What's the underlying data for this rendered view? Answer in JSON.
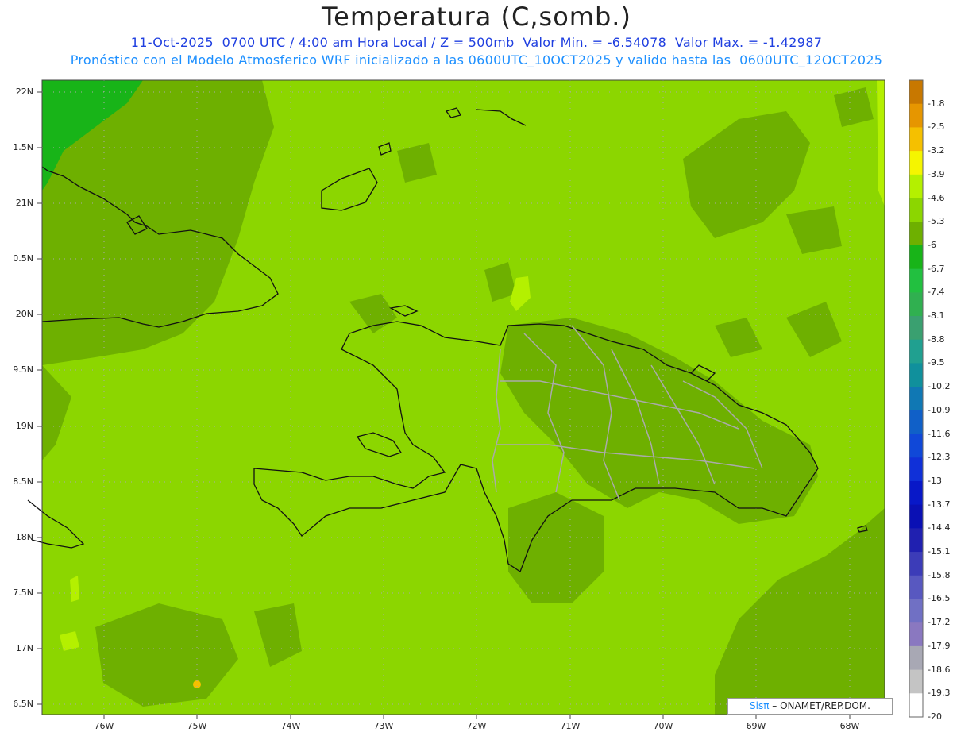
{
  "header": {
    "title": "Temperatura (C,somb.)",
    "subtitle_line1": "11-Oct-2025  0700 UTC / 4:00 am Hora Local / Z = 500mb  Valor Min. = -6.54078  Valor Max. = -1.42987",
    "subtitle_line2": "Pronóstico con el Modelo Atmosferico WRF inicializado a las 0600UTC_10OCT2025 y valido hasta las  0600UTC_12OCT2025"
  },
  "axes": {
    "lat_labels": [
      "22N",
      "1.5N",
      "21N",
      "0.5N",
      "20N",
      "9.5N",
      "19N",
      "8.5N",
      "18N",
      "7.5N",
      "17N",
      "6.5N"
    ],
    "lon_labels": [
      "76W",
      "75W",
      "74W",
      "73W",
      "72W",
      "71W",
      "70W",
      "69W",
      "68W"
    ]
  },
  "colorbar": {
    "labels": [
      "-1.8",
      "-2.5",
      "-3.2",
      "-3.9",
      "-4.6",
      "-5.3",
      "-6",
      "-6.7",
      "-7.4",
      "-8.1",
      "-8.8",
      "-9.5",
      "-10.2",
      "-10.9",
      "-11.6",
      "-12.3",
      "-13",
      "-13.7",
      "-14.4",
      "-15.1",
      "-15.8",
      "-16.5",
      "-17.2",
      "-17.9",
      "-18.6",
      "-19.3",
      "-20"
    ],
    "colors": [
      "#c87800",
      "#e69600",
      "#f5c000",
      "#f5f500",
      "#b4f000",
      "#8cd600",
      "#6eb000",
      "#18b418",
      "#22c040",
      "#30b050",
      "#3aa070",
      "#20a090",
      "#10909c",
      "#1078b4",
      "#1060c8",
      "#1048d8",
      "#1030d8",
      "#0818c8",
      "#0a10b4",
      "#2020b0",
      "#3c3cb8",
      "#5858c0",
      "#7070c4",
      "#8a78c0",
      "#a8a8b4",
      "#c4c4c4",
      "#ffffff"
    ]
  },
  "credit": {
    "sis": "Sisπ",
    "rest": " – ONAMET/REP.DOM."
  }
}
